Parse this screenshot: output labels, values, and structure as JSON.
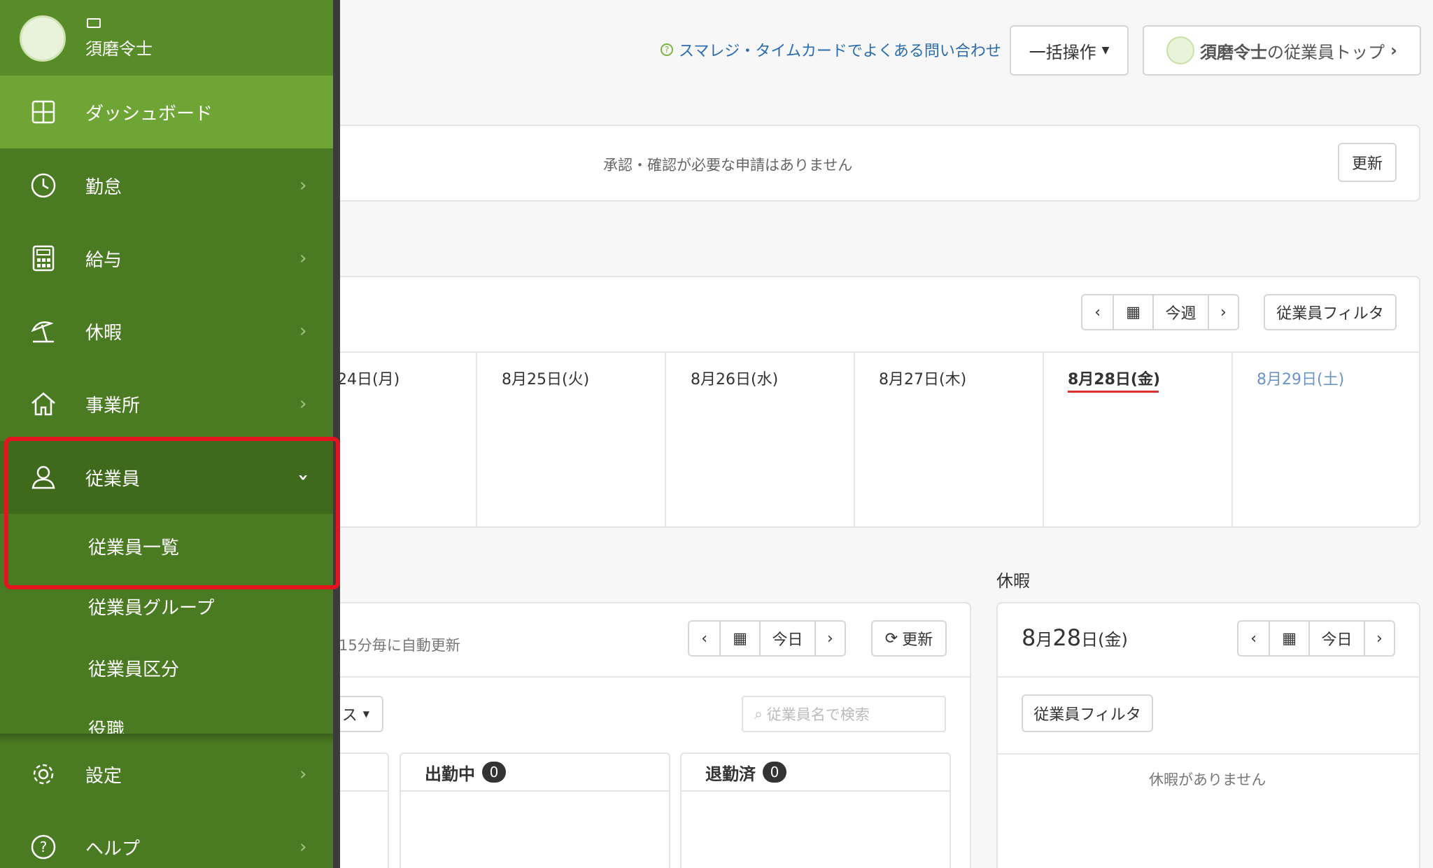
{
  "header": {
    "help_link": "スマレジ・タイムカードでよくある問い合わせ",
    "bulk_button": "一括操作",
    "employee_top_name": "須磨令士",
    "employee_top_suffix": "の従業員トップ"
  },
  "sidebar": {
    "user_name": "須磨令士",
    "items": [
      {
        "label": "ダッシュボード",
        "icon": "dashboard-icon"
      },
      {
        "label": "勤怠",
        "icon": "clock-icon"
      },
      {
        "label": "給与",
        "icon": "calculator-icon"
      },
      {
        "label": "休暇",
        "icon": "beach-umbrella-icon"
      },
      {
        "label": "事業所",
        "icon": "home-icon"
      },
      {
        "label": "従業員",
        "icon": "user-icon"
      },
      {
        "label": "設定",
        "icon": "gear-icon"
      },
      {
        "label": "ヘルプ",
        "icon": "help-icon"
      }
    ],
    "subitems": [
      "従業員一覧",
      "従業員グループ",
      "従業員区分",
      "役職"
    ]
  },
  "approval": {
    "message": "承認・確認が必要な申請はありません",
    "refresh": "更新"
  },
  "week": {
    "this_week": "今週",
    "filter": "従業員フィルタ",
    "prev": "‹",
    "next": "›",
    "days": [
      "24日(月)",
      "8月25日(火)",
      "8月26日(水)",
      "8月27日(木)",
      "8月28日(金)",
      "8月29日(土)"
    ]
  },
  "status": {
    "auto_update": "15分毎に自動更新",
    "today": "今日",
    "refresh": "更新",
    "dropdown": "ス",
    "search_placeholder": "従業員名で検索",
    "columns": [
      {
        "label": "出勤中",
        "count": "0"
      },
      {
        "label": "退勤済",
        "count": "0"
      }
    ]
  },
  "leave": {
    "section_title": "休暇",
    "date_month": "8",
    "date_month_unit": "月",
    "date_day": "28",
    "date_day_unit": "日(金)",
    "today": "今日",
    "filter": "従業員フィルタ",
    "empty": "休暇がありません"
  },
  "colors": {
    "sidebar": "#4a7a22",
    "sidebar_active": "#6ea535",
    "highlight": "#e4151f",
    "link": "#2b6cb0",
    "today_underline": "#d9302b",
    "saturday": "#6a95c9"
  }
}
